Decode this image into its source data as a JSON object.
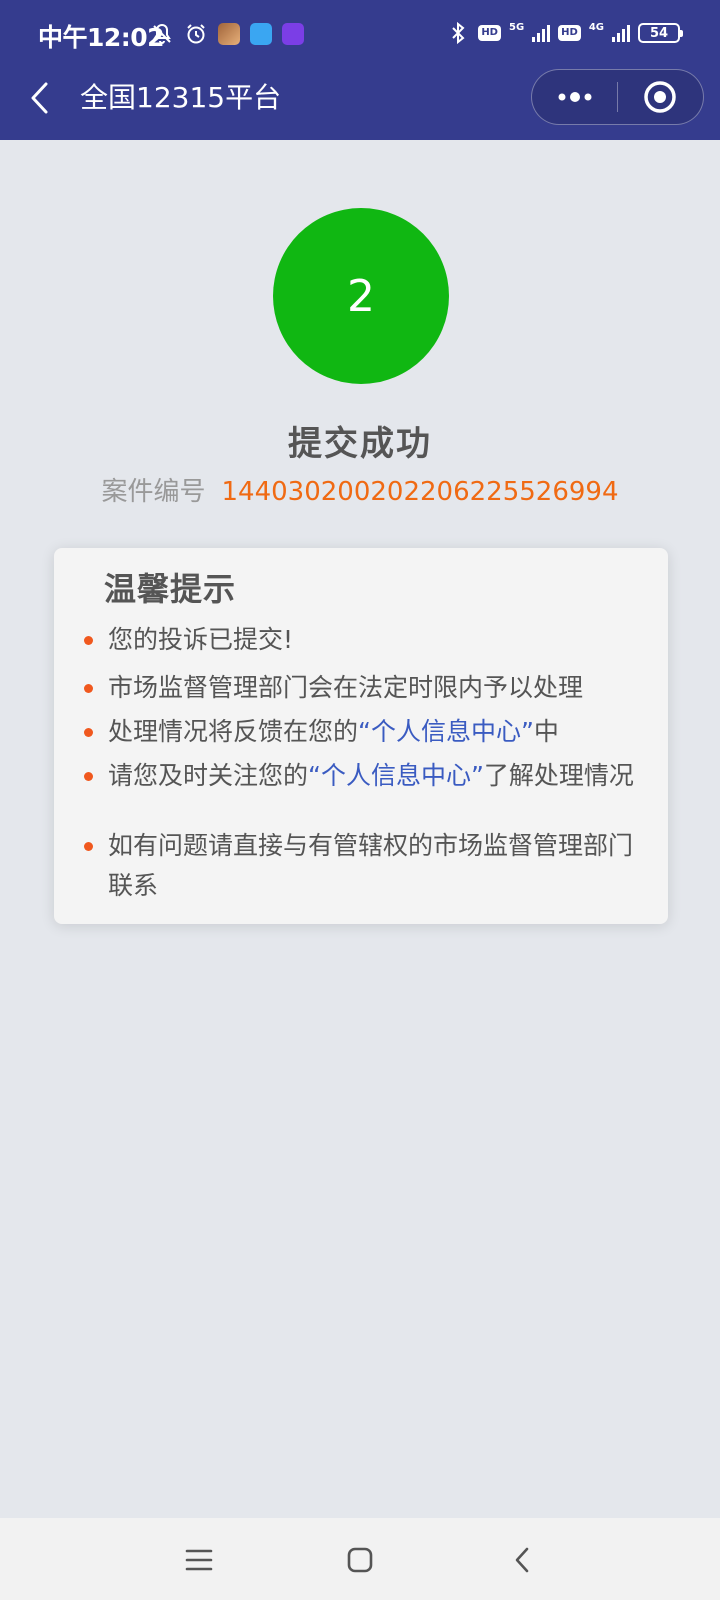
{
  "status_bar": {
    "time": "中午12:02",
    "battery": "54",
    "net_5g": "5G",
    "net_4g": "4G",
    "hd": "HD"
  },
  "nav": {
    "title": "全国12315平台"
  },
  "result": {
    "step_number": "2",
    "title": "提交成功",
    "case_label": "案件编号",
    "case_number": "144030200202206225526994"
  },
  "tips": {
    "title": "温馨提示",
    "items": [
      {
        "text": "您的投诉已提交!"
      },
      {
        "text": "市场监督管理部门会在法定时限内予以处理"
      },
      {
        "before": "处理情况将反馈在您的",
        "highlight": "“个人信息中心”",
        "after": "中"
      },
      {
        "before": "请您及时关注您的",
        "highlight": "“个人信息中心”",
        "after": "了解处理情况"
      },
      {
        "text": "如有问题请直接与有管辖权的市场监督管理部门联系"
      }
    ]
  },
  "colors": {
    "header": "#353c8e",
    "step_green": "#10b712",
    "case_number": "#f06a13",
    "bullet": "#f0581e",
    "highlight": "#3a5bc1"
  }
}
